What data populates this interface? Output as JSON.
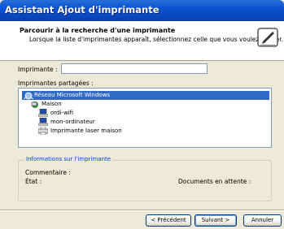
{
  "window": {
    "title": "Assistant Ajout d'imprimante"
  },
  "header": {
    "title": "Parcourir à la recherche d'une imprimante",
    "subtitle": "Lorsque la liste d'imprimantes apparaît, sélectionnez celle que vous voulez utiliser."
  },
  "printer_field": {
    "label": "Imprimante :",
    "value": ""
  },
  "shared": {
    "label": "Imprimantes partagées :",
    "items": [
      {
        "label": "Réseau Microsoft Windows",
        "icon": "network-icon",
        "selected": true
      },
      {
        "label": "Maison",
        "icon": "workgroup-icon",
        "selected": false
      },
      {
        "label": "ordi-wifi",
        "icon": "computer-icon",
        "selected": false
      },
      {
        "label": "mon-ordinateur",
        "icon": "computer-icon",
        "selected": false
      },
      {
        "label": "Imprimante laser maison",
        "icon": "printer-icon",
        "selected": false
      }
    ]
  },
  "info": {
    "title": "Informations sur l'imprimante",
    "comment_label": "Commentaire :",
    "state_label": "État :",
    "pending_label": "Documents en attente :"
  },
  "buttons": {
    "back": "< Précédent",
    "next": "Suivant >",
    "cancel": "Annuler"
  },
  "colors": {
    "title_bar": "#0b55d5",
    "selection": "#316ac5",
    "dialog_bg": "#ece9d8"
  }
}
